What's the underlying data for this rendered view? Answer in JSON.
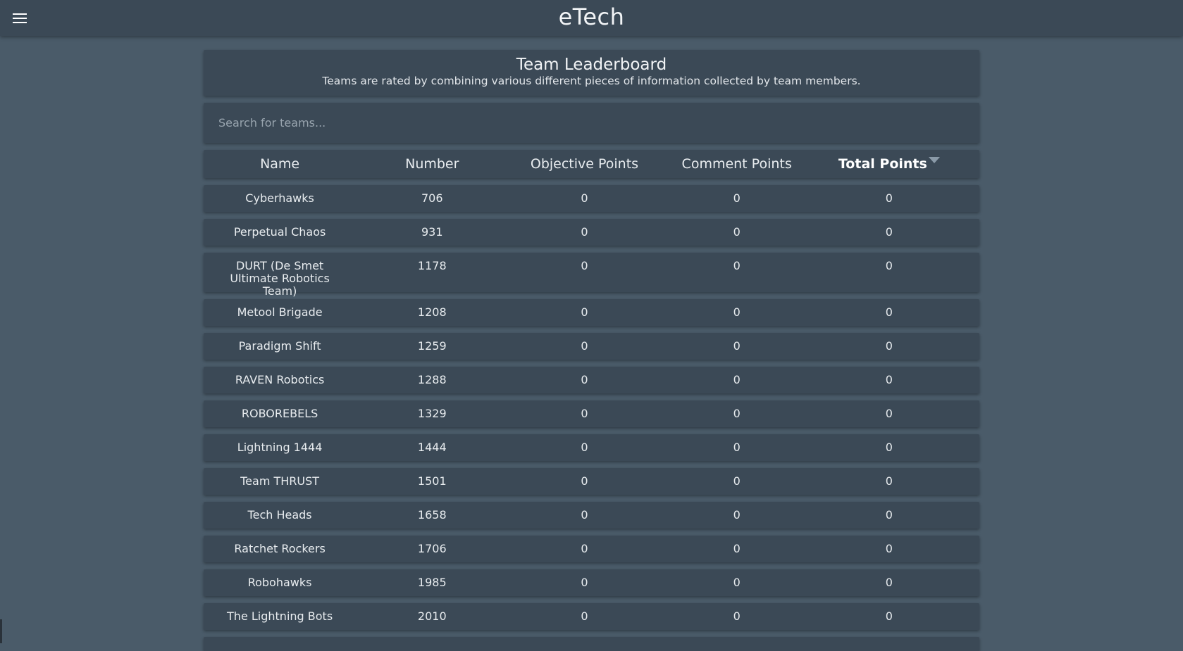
{
  "app": {
    "title": "eTech"
  },
  "leaderboard": {
    "title": "Team Leaderboard",
    "subtitle": "Teams are rated by combining various different pieces of information collected by team members."
  },
  "search": {
    "placeholder": "Search for teams..."
  },
  "table": {
    "columns": [
      "Name",
      "Number",
      "Objective Points",
      "Comment Points",
      "Total Points"
    ],
    "sorted_column": "Total Points",
    "sort_direction": "descending",
    "rows": [
      {
        "name": "Cyberhawks",
        "number": "706",
        "objective": "0",
        "comment": "0",
        "total": "0"
      },
      {
        "name": "Perpetual Chaos",
        "number": "931",
        "objective": "0",
        "comment": "0",
        "total": "0"
      },
      {
        "name": "DURT  (De Smet Ultimate Robotics Team)",
        "number": "1178",
        "objective": "0",
        "comment": "0",
        "total": "0"
      },
      {
        "name": "Metool Brigade",
        "number": "1208",
        "objective": "0",
        "comment": "0",
        "total": "0"
      },
      {
        "name": "Paradigm Shift",
        "number": "1259",
        "objective": "0",
        "comment": "0",
        "total": "0"
      },
      {
        "name": "RAVEN Robotics",
        "number": "1288",
        "objective": "0",
        "comment": "0",
        "total": "0"
      },
      {
        "name": "ROBOREBELS",
        "number": "1329",
        "objective": "0",
        "comment": "0",
        "total": "0"
      },
      {
        "name": "Lightning 1444",
        "number": "1444",
        "objective": "0",
        "comment": "0",
        "total": "0"
      },
      {
        "name": "Team THRUST",
        "number": "1501",
        "objective": "0",
        "comment": "0",
        "total": "0"
      },
      {
        "name": "Tech Heads",
        "number": "1658",
        "objective": "0",
        "comment": "0",
        "total": "0"
      },
      {
        "name": "Ratchet Rockers",
        "number": "1706",
        "objective": "0",
        "comment": "0",
        "total": "0"
      },
      {
        "name": "Robohawks",
        "number": "1985",
        "objective": "0",
        "comment": "0",
        "total": "0"
      },
      {
        "name": "The Lightning Bots",
        "number": "2010",
        "objective": "0",
        "comment": "0",
        "total": "0"
      }
    ]
  },
  "colors": {
    "background": "#4a5b69",
    "card": "#3b4956",
    "text": "#e8ecef",
    "sort_arrow": "#8a9aa8"
  },
  "icons": {
    "menu": "hamburger-menu-icon",
    "sort": "sort-descending-icon"
  }
}
